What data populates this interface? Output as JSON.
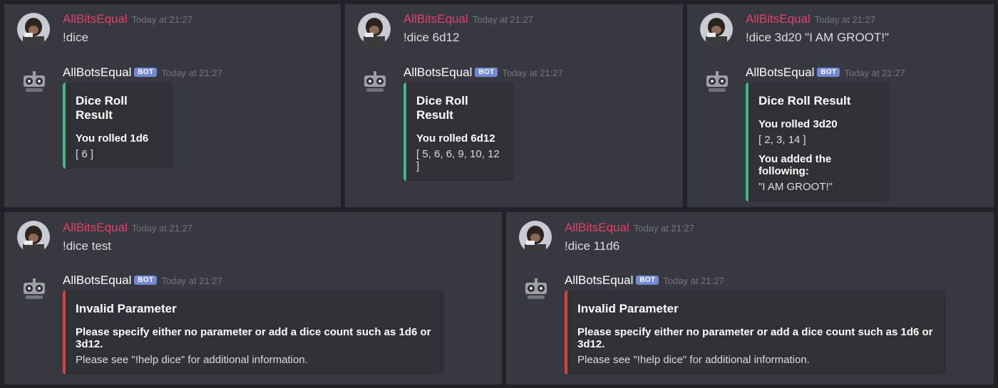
{
  "messages": [
    {
      "user": "AllBitsEqual",
      "user_time": "Today at 21:27",
      "command": "!dice",
      "bot": "AllBotsEqual",
      "bot_tag": "BOT",
      "bot_time": "Today at 21:27",
      "embed": {
        "title": "Dice Roll Result",
        "fields": [
          {
            "name": "You rolled 1d6",
            "value": "[ 6 ]"
          }
        ]
      }
    },
    {
      "user": "AllBitsEqual",
      "user_time": "Today at 21:27",
      "command": "!dice 6d12",
      "bot": "AllBotsEqual",
      "bot_tag": "BOT",
      "bot_time": "Today at 21:27",
      "embed": {
        "title": "Dice Roll Result",
        "fields": [
          {
            "name": "You rolled 6d12",
            "value": "[ 5, 6, 6, 9, 10, 12 ]"
          }
        ]
      }
    },
    {
      "user": "AllBitsEqual",
      "user_time": "Today at 21:27",
      "command": "!dice 3d20 \"I AM GROOT!\"",
      "bot": "AllBotsEqual",
      "bot_tag": "BOT",
      "bot_time": "Today at 21:27",
      "embed": {
        "title": "Dice Roll Result",
        "fields": [
          {
            "name": "You rolled 3d20",
            "value": "[ 2, 3, 14 ]"
          },
          {
            "name": "You added the following:",
            "value": "\"I AM GROOT!\""
          }
        ]
      }
    },
    {
      "user": "AllBitsEqual",
      "user_time": "Today at 21:27",
      "command": "!dice test",
      "bot": "AllBotsEqual",
      "bot_tag": "BOT",
      "bot_time": "Today at 21:27",
      "embed": {
        "title": "Invalid Parameter",
        "fields": [
          {
            "name": "Please specify either no parameter or add a dice count such as 1d6 or 3d12.",
            "value": "Please see \"!help dice\" for additional information."
          }
        ]
      }
    },
    {
      "user": "AllBitsEqual",
      "user_time": "Today at 21:27",
      "command": "!dice 11d6",
      "bot": "AllBotsEqual",
      "bot_tag": "BOT",
      "bot_time": "Today at 21:27",
      "embed": {
        "title": "Invalid Parameter",
        "fields": [
          {
            "name": "Please specify either no parameter or add a dice count such as 1d6 or 3d12.",
            "value": "Please see \"!help dice\" for additional information."
          }
        ]
      }
    }
  ],
  "colors": {
    "success": "#43b581",
    "error": "#d93d3d",
    "username": "#e63f6d",
    "bot_tag": "#7289da"
  }
}
